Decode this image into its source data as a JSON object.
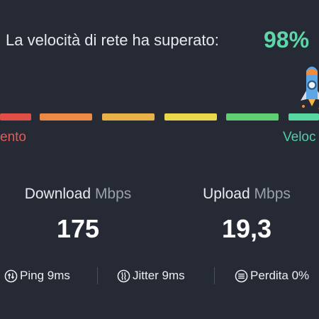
{
  "result": {
    "text": "La velocità di rete ha superato:",
    "percent": "98%"
  },
  "scale": {
    "left_label": "ento",
    "right_label": "Veloc",
    "segment_colors": [
      "#e04e45",
      "#ec8a44",
      "#e9b247",
      "#ead84a",
      "#5fcf73",
      "#56d8a3"
    ]
  },
  "download": {
    "label": "Download",
    "unit": "Mbps",
    "value": "175"
  },
  "upload": {
    "label": "Upload",
    "unit": "Mbps",
    "value": "19,3"
  },
  "stats": {
    "ping": "Ping 9ms",
    "jitter": "Jitter 9ms",
    "loss": "Perdita 0%"
  },
  "icons": {
    "rocket": "rocket-icon",
    "ping": "ping-icon",
    "jitter": "jitter-icon",
    "loss": "packet-loss-icon"
  },
  "colors": {
    "background": "#262a35",
    "accent": "#5fd6a8",
    "slow": "#e45b55",
    "fast": "#4fcfa8"
  }
}
